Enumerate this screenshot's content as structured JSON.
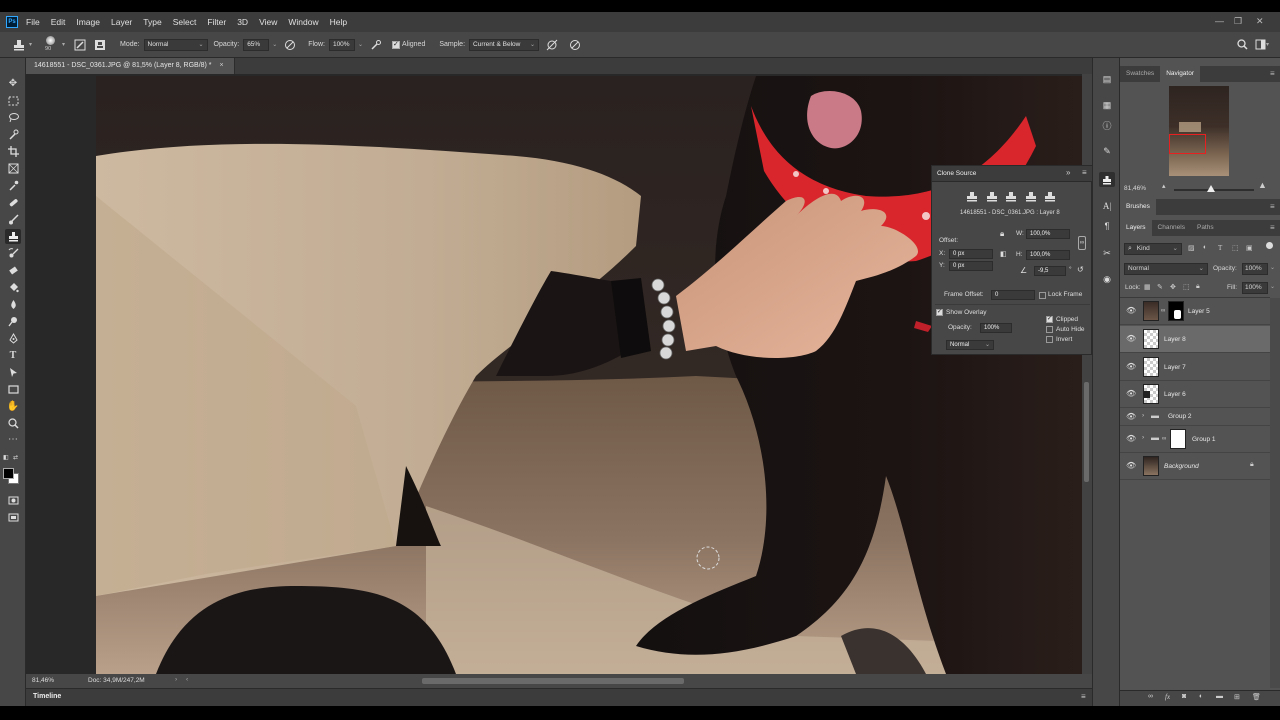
{
  "app": {
    "logo": "Ps"
  },
  "menu": [
    "File",
    "Edit",
    "Image",
    "Layer",
    "Type",
    "Select",
    "Filter",
    "3D",
    "View",
    "Window",
    "Help"
  ],
  "options": {
    "brush_size": "90",
    "mode_label": "Mode:",
    "mode_value": "Normal",
    "opacity_label": "Opacity:",
    "opacity_value": "65%",
    "flow_label": "Flow:",
    "flow_value": "100%",
    "aligned_label": "Aligned",
    "sample_label": "Sample:",
    "sample_value": "Current & Below"
  },
  "document": {
    "tab_title": "14618551 - DSC_0361.JPG @ 81,5% (Layer 8, RGB/8) *",
    "close": "×"
  },
  "status": {
    "zoom": "81,46%",
    "doc": "Doc: 34,9M/247,2M"
  },
  "timeline": {
    "label": "Timeline"
  },
  "clone_source": {
    "title": "Clone Source",
    "source_name": "14618551 - DSC_0361.JPG : Layer 8",
    "offset_label": "Offset:",
    "w_label": "W:",
    "w_value": "100,0%",
    "h_label": "H:",
    "h_value": "100,0%",
    "x_label": "X:",
    "x_value": "0 px",
    "y_label": "Y:",
    "y_value": "0 px",
    "angle_value": "-9,5",
    "angle_unit": "°",
    "frame_offset_label": "Frame Offset:",
    "frame_offset_value": "0",
    "lock_frame_label": "Lock Frame",
    "show_overlay_label": "Show Overlay",
    "overlay_opacity_label": "Opacity:",
    "overlay_opacity_value": "100%",
    "clipped_label": "Clipped",
    "autohide_label": "Auto Hide",
    "invert_label": "Invert",
    "blend_value": "Normal"
  },
  "navigator": {
    "tabs": [
      "Swatches",
      "Navigator"
    ],
    "zoom": "81,46%"
  },
  "brushes_tab": "Brushes",
  "layers_panel": {
    "tabs": [
      "Layers",
      "Channels",
      "Paths"
    ],
    "kind_label": "Kind",
    "blend_mode": "Normal",
    "opacity_label": "Opacity:",
    "opacity_value": "100%",
    "lock_label": "Lock:",
    "fill_label": "Fill:",
    "fill_value": "100%",
    "layers": [
      {
        "name": "Layer 5"
      },
      {
        "name": "Layer 8"
      },
      {
        "name": "Layer 7"
      },
      {
        "name": "Layer 6"
      },
      {
        "name": "Group 2"
      },
      {
        "name": "Group 1"
      },
      {
        "name": "Background"
      }
    ]
  },
  "colors": {
    "panel": "#535353",
    "dark": "#474747",
    "accent": "#31a8ff",
    "bandana": "#d8262c"
  }
}
